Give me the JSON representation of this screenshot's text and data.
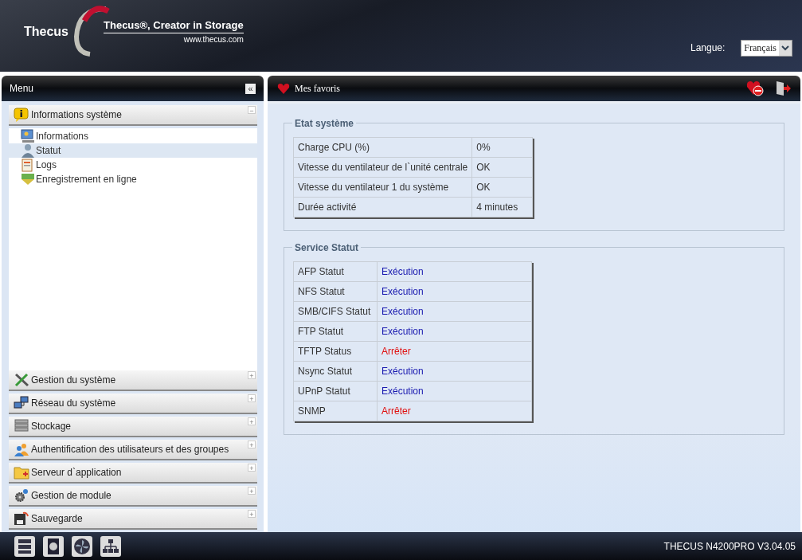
{
  "header": {
    "logo": "Thecus",
    "tagline": "Thecus®, Creator in Storage",
    "url": "www.thecus.com",
    "language_label": "Langue:",
    "language_value": "Français"
  },
  "sidebar": {
    "title": "Menu",
    "collapse_button": "«",
    "sections": [
      {
        "label": "Informations système",
        "expanded": true,
        "toggle": "−",
        "children": [
          {
            "label": "Informations",
            "selected": false
          },
          {
            "label": "Statut",
            "selected": true
          },
          {
            "label": "Logs",
            "selected": false
          },
          {
            "label": "Enregistrement en ligne",
            "selected": false
          }
        ]
      },
      {
        "label": "Gestion du système",
        "expanded": false,
        "toggle": "+"
      },
      {
        "label": "Réseau du système",
        "expanded": false,
        "toggle": "+"
      },
      {
        "label": "Stockage",
        "expanded": false,
        "toggle": "+"
      },
      {
        "label": "Authentification des utilisateurs et des groupes",
        "expanded": false,
        "toggle": "+"
      },
      {
        "label": "Serveur d`application",
        "expanded": false,
        "toggle": "+"
      },
      {
        "label": "Gestion de module",
        "expanded": false,
        "toggle": "+"
      },
      {
        "label": "Sauvegarde",
        "expanded": false,
        "toggle": "+"
      }
    ]
  },
  "favorites_bar": {
    "title": "Mes favoris"
  },
  "system_status": {
    "title": "Etat système",
    "rows": [
      {
        "label": "Charge CPU (%)",
        "value": "0%"
      },
      {
        "label": "Vitesse du ventilateur de l`unité centrale",
        "value": "OK"
      },
      {
        "label": "Vitesse du ventilateur 1 du système",
        "value": "OK"
      },
      {
        "label": "Durée activité",
        "value": "4 minutes"
      }
    ]
  },
  "service_status": {
    "title": "Service Statut",
    "rows": [
      {
        "label": "AFP Statut",
        "value": "Exécution",
        "kind": "running"
      },
      {
        "label": "NFS Statut",
        "value": "Exécution",
        "kind": "running"
      },
      {
        "label": "SMB/CIFS Statut",
        "value": "Exécution",
        "kind": "running"
      },
      {
        "label": "FTP Statut",
        "value": "Exécution",
        "kind": "running"
      },
      {
        "label": "TFTP Status",
        "value": "Arrêter",
        "kind": "stopped"
      },
      {
        "label": "Nsync Statut",
        "value": "Exécution",
        "kind": "running"
      },
      {
        "label": "UPnP Statut",
        "value": "Exécution",
        "kind": "running"
      },
      {
        "label": "SNMP",
        "value": "Arrêter",
        "kind": "stopped"
      }
    ]
  },
  "status_bar": {
    "model": "THECUS N4200PRO V3.04.05"
  }
}
